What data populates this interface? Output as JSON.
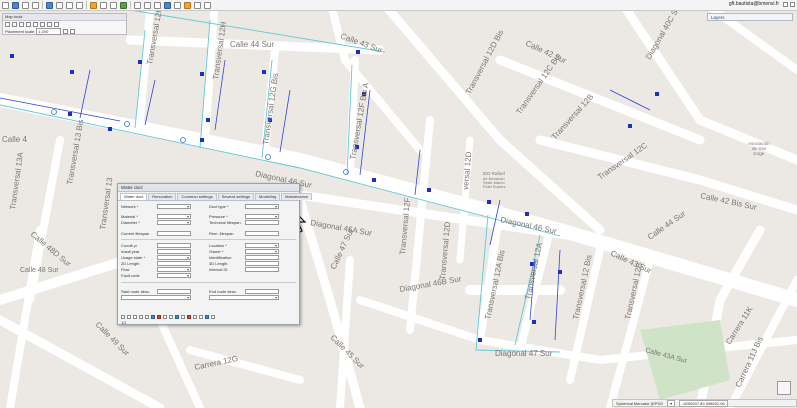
{
  "toolbar": {
    "user": "gft.bautista@bmenvi.fr"
  },
  "map_tools": {
    "title": "Map tools",
    "placement_label": "Placement scale",
    "placement_value": "1:200"
  },
  "layers": {
    "label": "Layers"
  },
  "panel": {
    "title": "Water duct",
    "tabs": [
      "Water duct",
      "Renovation",
      "Common settings",
      "Sewerd settings",
      "Modelling",
      "Maintenance"
    ],
    "fields_left_top": [
      "Network *",
      "Material *",
      "Diameter *",
      "Current lifespan"
    ],
    "fields_right_top": [
      "Duct type *",
      "Pressure *",
      "Technical lifespan",
      "Rem. lifespan"
    ],
    "fields_left_mid": [
      "Condit yr",
      "Instal year",
      "Usage state *",
      "2D Length",
      "Flow",
      "Fault code"
    ],
    "fields_right_mid": [
      "Location *",
      "Owner *",
      "Identification",
      "3D Length",
      "Internal ID"
    ],
    "fields_bottom": [
      "Start node desc.",
      "End node desc."
    ],
    "footer": "1/1"
  },
  "map_labels": {
    "calle_43_sur_top": "Calle 43 Sur",
    "calle_42_sur": "Calle 42 Sur",
    "diagonal_40c_sur": "Diagonal 40C Sur",
    "transversal_12d_bis": "Transversal 12D Bis",
    "transversal_12c_bis": "Transversal 12C Bis",
    "transversal_12b": "Transversal 12B",
    "transversal_12f_bis_a": "Transversal 12F Bis A",
    "transversal_12g_bis": "Transversal 12G Bis",
    "transversal_12h": "Transversal 12H",
    "transversal_13_bis": "Transversal 13 Bis",
    "transversal_13a": "Transversal 13A",
    "transversal_13": "Transversal 13",
    "calle_44_sur": "Calle 44 Sur",
    "diagonal_46_sur": "Diagonal 46 Sur",
    "diagonal_46_sur_2": "Diagonal 46 Sur",
    "diagonal_46a_sur": "Diagonal 46A Sur",
    "diagonal_46b_sur": "Diagonal 46B Sur",
    "diagonal_47_sur": "Diagonal 47 Sur",
    "transversal_12f": "Transversal 12F",
    "transversal_12d": "Transversal 12D",
    "transversal_12_bis": "Transversal 12 Bis",
    "transversal_12a": "Transversal 12A",
    "transversal_12_bis_a": "Transversal 12 Bis",
    "transversal_12a_bis": "Transversal 12A Bis",
    "transversal_12b_2": "Transversal 12B",
    "transversal_12c": "Transversal 12C",
    "calle_42_bis_sur": "Calle 42 Bis Sur",
    "calle_43_sur_right": "Calle 43 Sur",
    "calle_44_sur_right": "Calle 44 Sur",
    "carrera_11k": "Carrera 11K",
    "carrera_11j_bis": "Carrera 11J Bis",
    "calle_43a_sur": "Calle 43A Sur",
    "calle_48d_sur": "Calle 48D Sur",
    "calle_48_sur": "Calle 48 Sur",
    "calle_49_sur": "Calle 49 Sur",
    "calle_47_sur": "Calle 47 Sur",
    "calle_45_sur": "Calle 45 Sur",
    "carrera_12g": "Carrera 12G",
    "ied_rafael": "IED Rafael",
    "de_armando": "de Armando",
    "sede_marco": "Sede Marco",
    "fidel_suarez": "Fidel Suárez",
    "asociacion": "Asociación",
    "de_san": "de San",
    "jorge": "Jorge",
    "versal_12d": "versal 12D",
    "calle_45_left": "Calle 4"
  },
  "status": {
    "projection": "Spherical Mercator (EPSG",
    "coords": "-8250507.89 558652.06"
  }
}
